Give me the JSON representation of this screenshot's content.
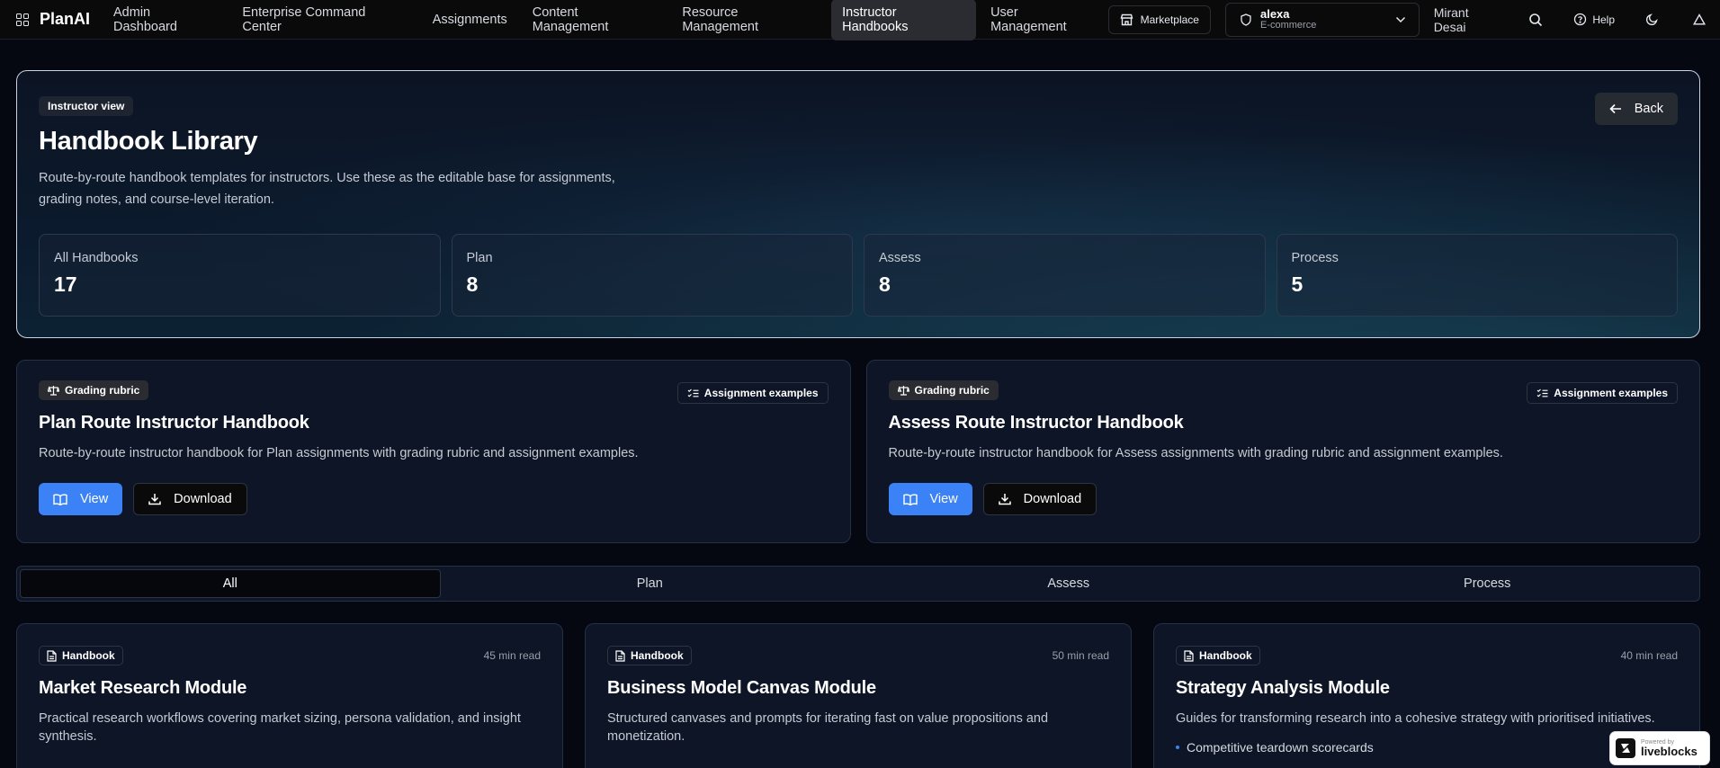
{
  "nav": {
    "brand": "PlanAI",
    "links": [
      {
        "label": "Admin Dashboard"
      },
      {
        "label": "Enterprise Command Center"
      },
      {
        "label": "Assignments"
      },
      {
        "label": "Content Management"
      },
      {
        "label": "Resource Management"
      },
      {
        "label": "Instructor Handbooks",
        "active": true
      },
      {
        "label": "User Management"
      }
    ],
    "marketplace": "Marketplace",
    "org": {
      "name": "alexa",
      "sub": "E-commerce"
    },
    "user": "Mirant Desai",
    "help": "Help"
  },
  "hero": {
    "pill": "Instructor view",
    "title": "Handbook Library",
    "description": "Route-by-route handbook templates for instructors. Use these as the editable base for assignments, grading notes, and course-level iteration.",
    "back": "Back",
    "stats": [
      {
        "label": "All Handbooks",
        "value": "17"
      },
      {
        "label": "Plan",
        "value": "8"
      },
      {
        "label": "Assess",
        "value": "8"
      },
      {
        "label": "Process",
        "value": "5"
      }
    ]
  },
  "featured": [
    {
      "tag": "Grading rubric",
      "tag2": "Assignment examples",
      "title": "Plan Route Instructor Handbook",
      "description": "Route-by-route instructor handbook for Plan assignments with grading rubric and assignment examples.",
      "view": "View",
      "download": "Download"
    },
    {
      "tag": "Grading rubric",
      "tag2": "Assignment examples",
      "title": "Assess Route Instructor Handbook",
      "description": "Route-by-route instructor handbook for Assess assignments with grading rubric and assignment examples.",
      "view": "View",
      "download": "Download"
    }
  ],
  "tabs": [
    {
      "label": "All",
      "active": true
    },
    {
      "label": "Plan"
    },
    {
      "label": "Assess"
    },
    {
      "label": "Process"
    }
  ],
  "cards": [
    {
      "tag": "Handbook",
      "read": "45 min read",
      "title": "Market Research Module",
      "description": "Practical research workflows covering market sizing, persona validation, and insight synthesis.",
      "bullets": []
    },
    {
      "tag": "Handbook",
      "read": "50 min read",
      "title": "Business Model Canvas Module",
      "description": "Structured canvases and prompts for iterating fast on value propositions and monetization.",
      "bullets": []
    },
    {
      "tag": "Handbook",
      "read": "40 min read",
      "title": "Strategy Analysis Module",
      "description": "Guides for transforming research into a cohesive strategy with prioritised initiatives.",
      "bullets": [
        "Competitive teardown scorecards"
      ]
    }
  ],
  "badge": {
    "small": "Powered by",
    "big": "liveblocks"
  },
  "colors": {
    "accent": "#3b82f6",
    "card_bg": "#0d1526",
    "border": "#243147"
  }
}
